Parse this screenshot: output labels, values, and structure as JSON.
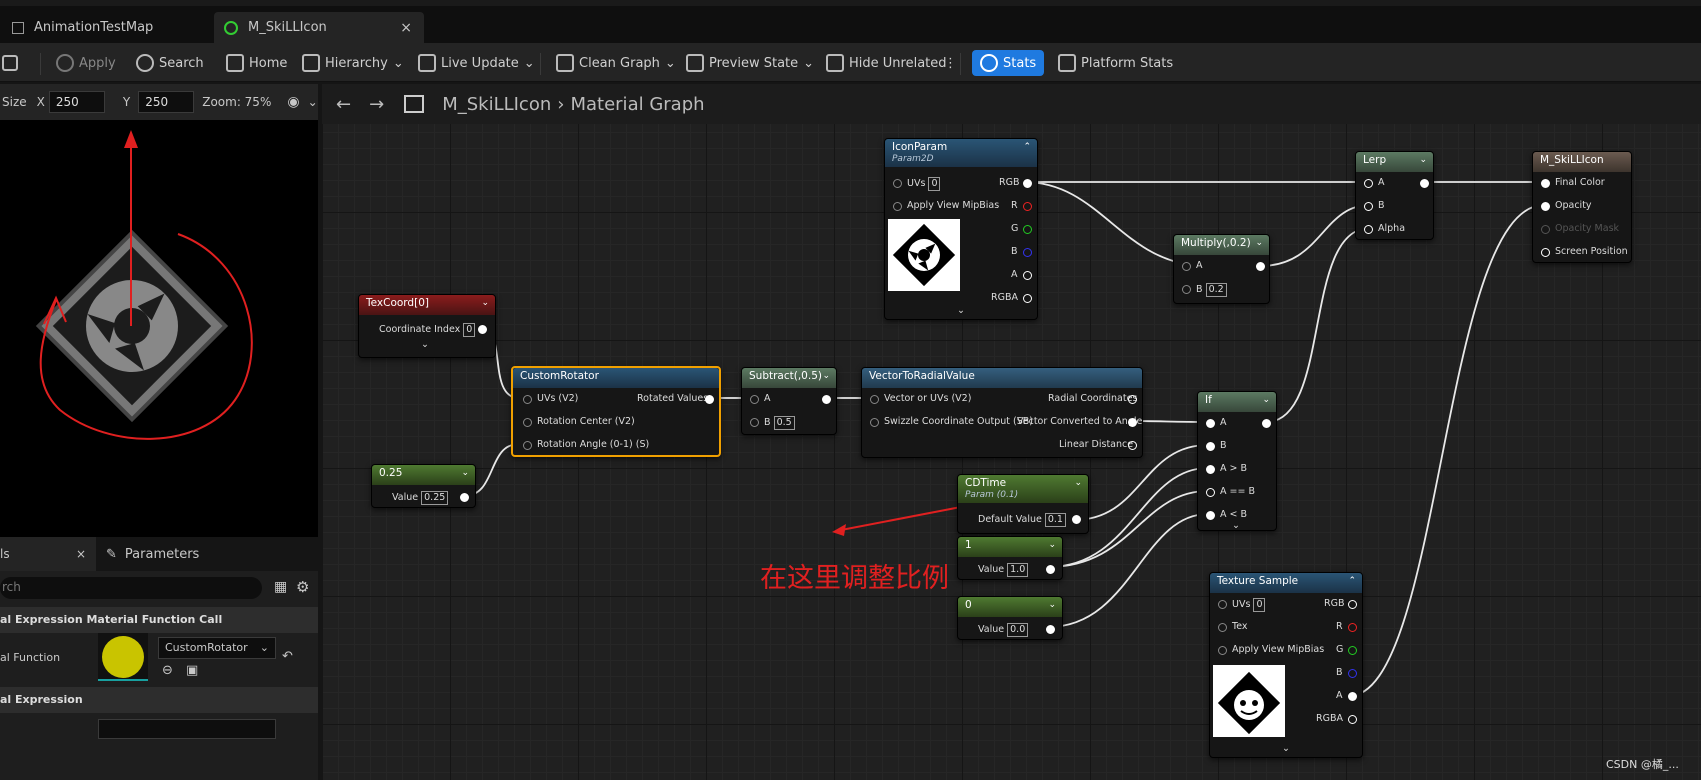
{
  "tabs": [
    {
      "label": "AnimationTestMap"
    },
    {
      "label": "M_SkiLLIcon"
    }
  ],
  "toolbar": {
    "apply": "Apply",
    "search": "Search",
    "home": "Home",
    "hierarchy": "Hierarchy",
    "live_update": "Live Update",
    "clean_graph": "Clean Graph",
    "preview_state": "Preview State",
    "hide_unrelated": "Hide Unrelated",
    "stats": "Stats",
    "platform_stats": "Platform Stats"
  },
  "viewport": {
    "size_label": "Size",
    "x_label": "X",
    "x_value": "250",
    "y_label": "Y",
    "y_value": "250",
    "zoom": "Zoom: 75%"
  },
  "details": {
    "tab_details": "ls",
    "tab_parameters": "Parameters",
    "search_placeholder": "rch",
    "section1": "al Expression Material Function Call",
    "function_label": "al Function",
    "function_value": "CustomRotator",
    "section2": "al Expression"
  },
  "graph": {
    "breadcrumb_asset": "M_SkiLLIcon",
    "breadcrumb_graph": "Material Graph",
    "annotation": "在这里调整比例",
    "watermark": "CSDN @橘_..."
  },
  "nodes": {
    "texcoord": {
      "title": "TexCoord[0]",
      "label": "Coordinate Index",
      "value": "0"
    },
    "const025": {
      "title": "0.25",
      "label": "Value",
      "value": "0.25"
    },
    "rotator": {
      "title": "CustomRotator",
      "in1": "UVs (V2)",
      "in2": "Rotation Center (V2)",
      "in3": "Rotation Angle (0-1) (S)",
      "out": "Rotated Values"
    },
    "subtract": {
      "title": "Subtract(,0.5)",
      "a": "A",
      "b": "B",
      "b_value": "0.5"
    },
    "radial": {
      "title": "VectorToRadialValue",
      "in1": "Vector or UVs (V2)",
      "in2": "Swizzle Coordinate Output (SB)",
      "out1": "Radial Coordinates",
      "out2": "Vector Converted to Angle",
      "out3": "Linear Distance"
    },
    "iconparam": {
      "title": "IconParam",
      "subtitle": "Param2D",
      "uvs": "UVs",
      "uvs_value": "0",
      "mip": "Apply View MipBias",
      "rgb": "RGB",
      "r": "R",
      "g": "G",
      "b": "B",
      "a": "A",
      "rgba": "RGBA"
    },
    "multiply": {
      "title": "Multiply(,0.2)",
      "a": "A",
      "b": "B",
      "b_value": "0.2"
    },
    "lerp": {
      "title": "Lerp",
      "a": "A",
      "b": "B",
      "alpha": "Alpha"
    },
    "output": {
      "title": "M_SkiLLIcon",
      "final_color": "Final Color",
      "opacity": "Opacity",
      "opacity_mask": "Opacity Mask",
      "screen_position": "Screen Position"
    },
    "cdtime": {
      "title": "CDTime",
      "subtitle": "Param (0.1)",
      "label": "Default Value",
      "value": "0.1"
    },
    "const1": {
      "title": "1",
      "label": "Value",
      "value": "1.0"
    },
    "const0": {
      "title": "0",
      "label": "Value",
      "value": "0.0"
    },
    "ifnode": {
      "title": "If",
      "a": "A",
      "b": "B",
      "agb": "A > B",
      "aeb": "A == B",
      "alb": "A < B"
    },
    "texsample": {
      "title": "Texture Sample",
      "uvs": "UVs",
      "uvs_value": "0",
      "tex": "Tex",
      "mip": "Apply View MipBias",
      "rgb": "RGB",
      "r": "R",
      "g": "G",
      "b": "B",
      "a": "A",
      "rgba": "RGBA"
    }
  },
  "colors": {
    "accent": "#1f7ae0",
    "selected": "#f0a000",
    "annotation": "#e02020"
  }
}
